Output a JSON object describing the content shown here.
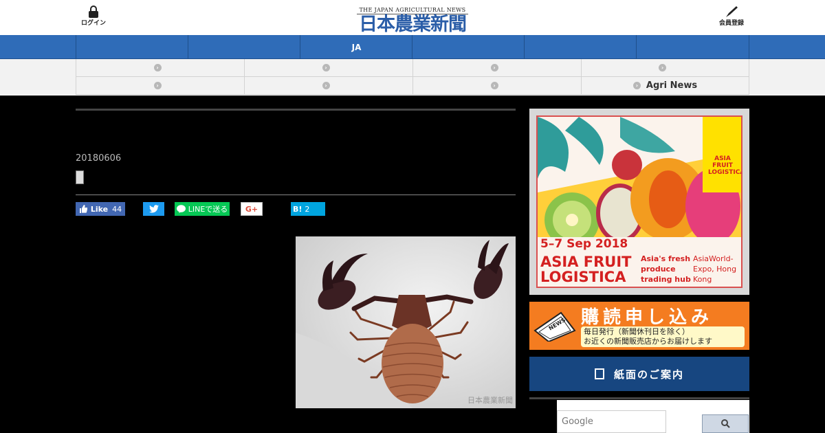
{
  "header": {
    "login_label": "ログイン",
    "register_label": "会員登録",
    "logo_en": "THE JAPAN AGRICULTURAL NEWS",
    "logo_jp": "日本農業新聞",
    "brand_color": "#2f6cb8"
  },
  "nav": {
    "items": [
      "",
      "",
      "JA",
      "",
      "",
      ""
    ]
  },
  "subnav": {
    "rows": [
      [
        "",
        "",
        "",
        ""
      ],
      [
        "",
        "",
        "",
        "Agri News"
      ]
    ]
  },
  "article": {
    "date": "20180606",
    "photo_credit": "日本農業新聞"
  },
  "share": {
    "like_label": "Like",
    "like_count": "44",
    "tweet_icon": "twitter-bird-icon",
    "line_label": "LINEで送る",
    "gplus_label": "G+",
    "hatena_label": "B!",
    "hatena_count": "2"
  },
  "sidebar": {
    "ad": {
      "date": "5–7 Sep 2018",
      "name": "ASIA FRUIT LOGISTICA",
      "tagline": "Asia's fresh produce trading hub",
      "venue": "AsiaWorld-Expo, Hong Kong",
      "brand": "ASIA FRUIT LOGISTICA"
    },
    "subscribe": {
      "title": "購読申し込み",
      "line1": "毎日発行（新聞休刊日を除く）",
      "line2": "お近くの新聞販売店からお届けします",
      "icon_text": "NEWS"
    },
    "paper_label": "紙面のご案内",
    "search": {
      "placeholder": "Google",
      "button_icon": "search-icon"
    }
  }
}
